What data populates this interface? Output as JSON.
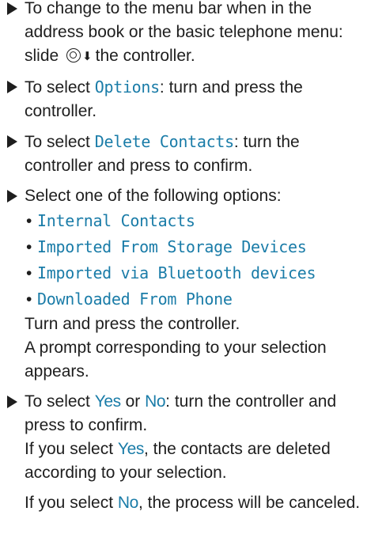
{
  "steps": [
    {
      "pre": "To change to the menu bar when in the address book or the basic telephone menu: slide",
      "post": "the controller."
    },
    {
      "pre": "To select ",
      "term": "Options",
      "post": ": turn and press the controller."
    },
    {
      "pre": "To select ",
      "term": "Delete Contacts",
      "post": ": turn the controller and press to confirm."
    },
    {
      "intro": "Select one of the following options:",
      "options": [
        "Internal Contacts",
        "Imported From Storage Devices",
        "Imported via Bluetooth devices",
        "Downloaded From Phone"
      ],
      "after_1": "Turn and press the controller.",
      "after_2": "A prompt corresponding to your selection appears."
    },
    {
      "pre": "To select ",
      "yes": "Yes",
      "mid": " or ",
      "no": "No",
      "post": ": turn the controller and press to confirm.",
      "yes_pre": "If you select ",
      "yes_post": ", the contacts are deleted according to your selection.",
      "no_pre": "If you select ",
      "no_post": ", the process will be canceled."
    }
  ],
  "icons": {
    "controller": "controller-icon",
    "slide_direction": "down-arrow-icon",
    "step_marker": "triangle-bullet-icon"
  },
  "colors": {
    "highlight": "#1a7ca8",
    "text": "#1e1e1e"
  }
}
